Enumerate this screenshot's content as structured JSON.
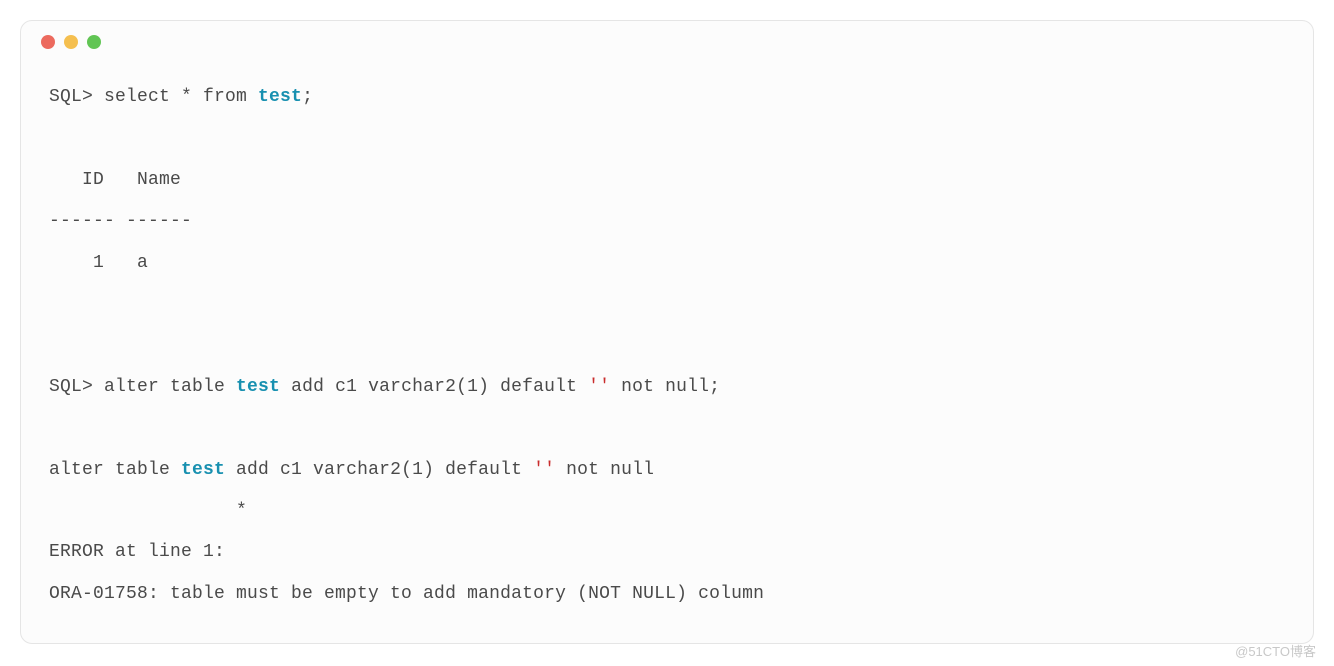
{
  "code": {
    "l1_prompt": "SQL> ",
    "l1_a": "select * from ",
    "l1_kw": "test",
    "l1_b": ";",
    "l2": "   ID   Name",
    "l3": "------ ------",
    "l4": "    1   a",
    "l5_blank": "",
    "l6_prompt": "SQL> ",
    "l6_a": "alter table ",
    "l6_kw": "test",
    "l6_b": " add c1 varchar2(1) default ",
    "l6_str": "''",
    "l6_c": " not null;",
    "l7_a": "alter table ",
    "l7_kw": "test",
    "l7_b": " add c1 varchar2(1) default ",
    "l7_str": "''",
    "l7_c": " not null",
    "l8": "                 *",
    "l9": "ERROR at line 1:",
    "l10": "ORA-01758: table must be empty to add mandatory (NOT NULL) column"
  },
  "watermark": "@51CTO博客"
}
